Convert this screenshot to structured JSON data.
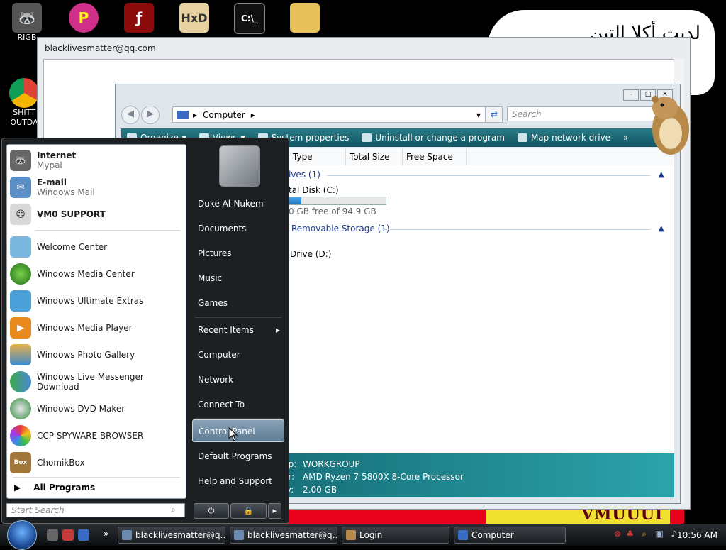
{
  "desktop_icons": [
    {
      "label": "RIGB",
      "icon": "raccoon-icon"
    },
    {
      "label": "",
      "icon": "p-app-icon"
    },
    {
      "label": "",
      "icon": "flash-icon"
    },
    {
      "label": "",
      "icon": "hxd-icon"
    },
    {
      "label": "",
      "icon": "cmd-icon"
    },
    {
      "label": "",
      "icon": "folder-icon"
    },
    {
      "label": "SHITT OUTDA",
      "icon": "chrome-icon"
    }
  ],
  "back_window": {
    "title": "blacklivesmatter@qq.com"
  },
  "explorer": {
    "address": "Computer",
    "search_placeholder": "Search",
    "toolbar": {
      "organize": "Organize",
      "views": "Views",
      "system_properties": "System properties",
      "uninstall": "Uninstall or change a program",
      "map_drive": "Map network drive",
      "more": "»"
    },
    "columns": [
      "Type",
      "Total Size",
      "Free Space"
    ],
    "groups": [
      {
        "label": "ives (1)"
      },
      {
        "label": "Removable Storage (1)"
      }
    ],
    "drive_c": {
      "name": "tal Disk (C:)",
      "free_text": "0 GB free of 94.9 GB",
      "used_fraction": 0.15
    },
    "drive_d": {
      "name": "Drive (D:)"
    },
    "details": {
      "workgroup_key": "up:",
      "workgroup_val": "WORKGROUP",
      "processor_key": "or:",
      "processor_val": "AMD Ryzen 7 5800X 8-Core Processor",
      "memory_key": "ry:",
      "memory_val": "2.00 GB"
    }
  },
  "start_menu": {
    "pinned": [
      {
        "title": "Internet",
        "subtitle": "Mypal",
        "icon": "raccoon-icon"
      },
      {
        "title": "E-mail",
        "subtitle": "Windows Mail",
        "icon": "mail-icon"
      },
      {
        "title": "VM0 SUPPORT",
        "subtitle": "",
        "icon": "support-icon"
      }
    ],
    "recent": [
      {
        "label": "Welcome Center",
        "icon": "welcome-center-icon"
      },
      {
        "label": "Windows Media Center",
        "icon": "media-center-icon"
      },
      {
        "label": "Windows Ultimate Extras",
        "icon": "ultimate-extras-icon"
      },
      {
        "label": "Windows Media Player",
        "icon": "media-player-icon"
      },
      {
        "label": "Windows Photo Gallery",
        "icon": "photo-gallery-icon"
      },
      {
        "label": "Windows Live Messenger Download",
        "icon": "messenger-icon"
      },
      {
        "label": "Windows DVD Maker",
        "icon": "dvd-maker-icon"
      },
      {
        "label": "CCP SPYWARE BROWSER",
        "icon": "browser-icon"
      },
      {
        "label": "ChomikBox",
        "icon": "chomikbox-icon"
      }
    ],
    "all_programs": "All Programs",
    "search_placeholder": "Start Search",
    "right_items": [
      "Duke Al-Nukem",
      "Documents",
      "Pictures",
      "Music",
      "Games",
      "Recent Items",
      "Computer",
      "Network",
      "Connect To",
      "Control Panel",
      "Default Programs",
      "Help and Support"
    ]
  },
  "taskbar": {
    "buttons": [
      "blacklivesmatter@q...",
      "blacklivesmatter@q...",
      "Login",
      "Computer"
    ],
    "clock": "10:56 AM"
  },
  "banner": {
    "text": "لدیت أكلا التین"
  },
  "strip": {
    "text": "VMUUUI"
  }
}
